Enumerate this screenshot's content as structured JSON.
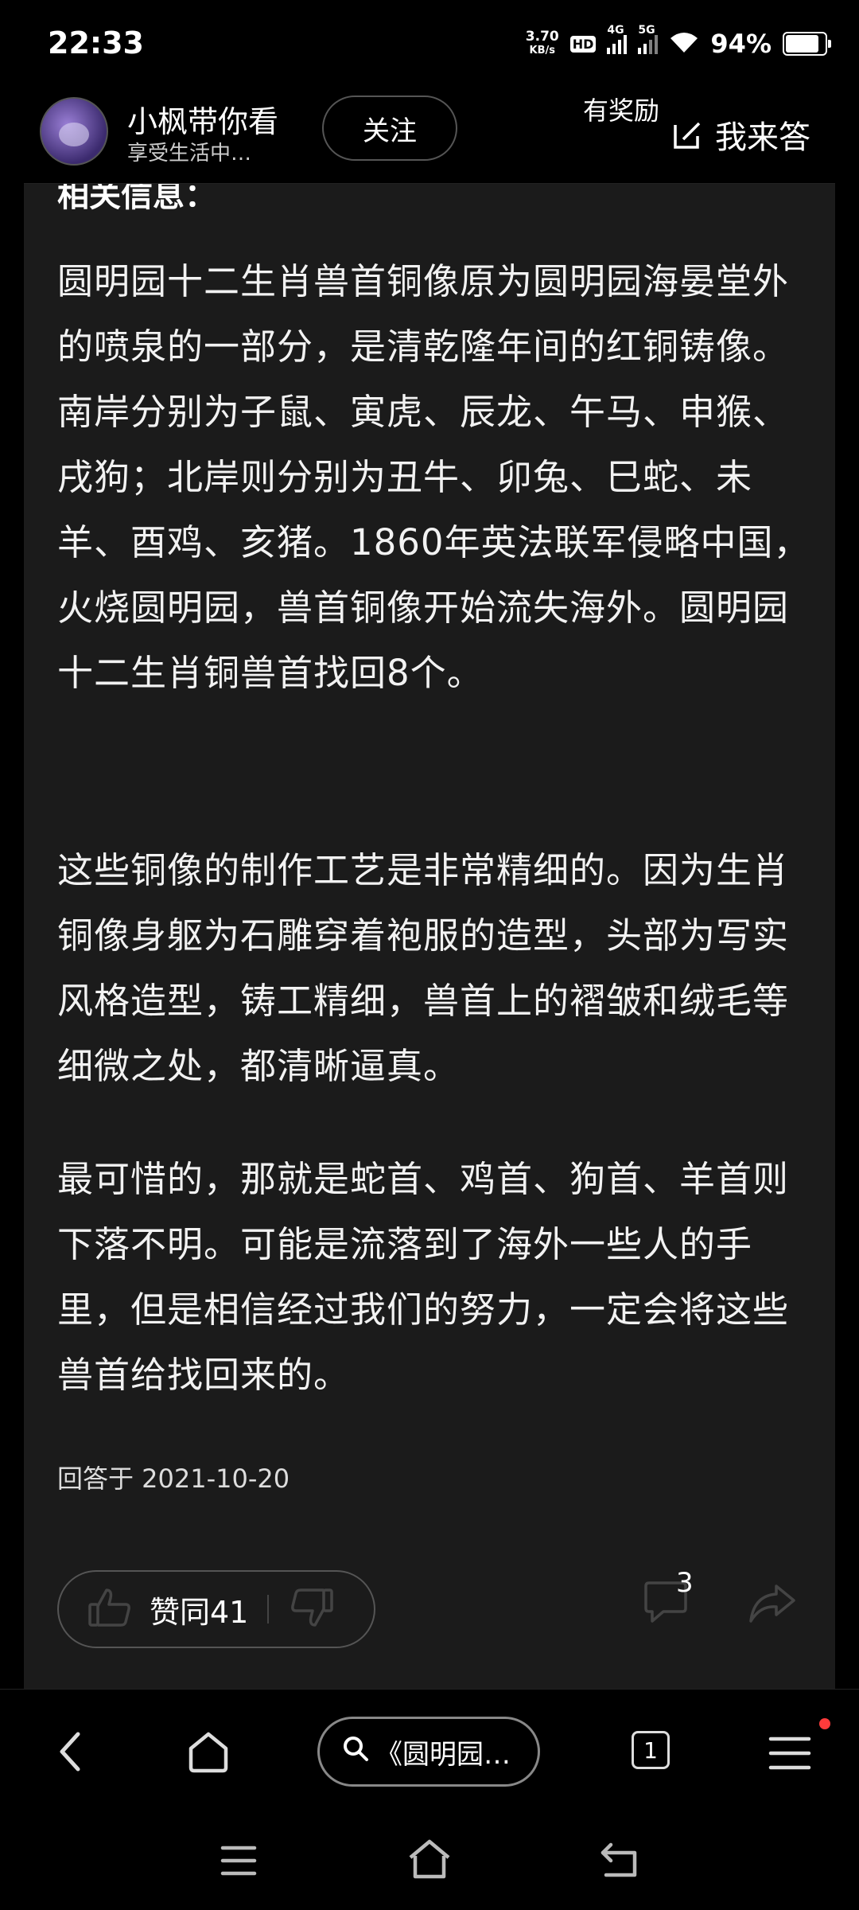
{
  "status_bar": {
    "time": "22:33",
    "net_speed_value": "3.70",
    "net_speed_unit": "KB/s",
    "hd_label": "HD",
    "sig1_label": "4G",
    "sig2_label": "5G",
    "battery_pct": "94%",
    "battery_level": 0.94
  },
  "author": {
    "name": "小枫带你看",
    "subtitle": "享受生活中…",
    "follow_label": "关注",
    "reward_label": "有奖励",
    "answer_label": "我来答"
  },
  "article": {
    "partial_heading": "相关信息：",
    "paragraphs": [
      "圆明园十二生肖兽首铜像原为圆明园海晏堂外的喷泉的一部分，是清乾隆年间的红铜铸像。南岸分别为子鼠、寅虎、辰龙、午马、申猴、戌狗；北岸则分别为丑牛、卯兔、巳蛇、未羊、酉鸡、亥猪。1860年英法联军侵略中国，火烧圆明园，兽首铜像开始流失海外。圆明园十二生肖铜兽首找回8个。",
      "这些铜像的制作工艺是非常精细的。因为生肖铜像身躯为石雕穿着袍服的造型，头部为写实风格造型，铸工精细，兽首上的褶皱和绒毛等细微之处，都清晰逼真。",
      "最可惜的，那就是蛇首、鸡首、狗首、羊首则下落不明。可能是流落到了海外一些人的手里，但是相信经过我们的努力，一定会将这些兽首给找回来的。"
    ],
    "answered_date": "回答于 2021-10-20"
  },
  "actions": {
    "agree_label": "赞同41",
    "comment_count": "3"
  },
  "bottom_nav": {
    "search_text": "《圆明园…",
    "tab_count": "1"
  }
}
